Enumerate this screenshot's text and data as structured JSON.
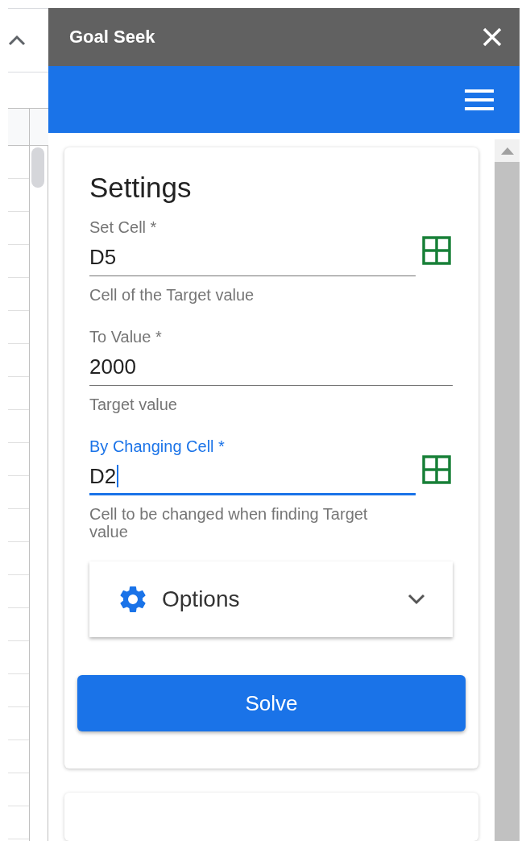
{
  "dialog": {
    "title": "Goal Seek"
  },
  "section": {
    "title": "Settings"
  },
  "fields": [
    {
      "label": "Set Cell *",
      "value": "D5",
      "hint": "Cell of the Target value",
      "focused": false,
      "has_picker": true
    },
    {
      "label": "To Value *",
      "value": "2000",
      "hint": "Target value",
      "focused": false,
      "has_picker": false
    },
    {
      "label": "By Changing Cell *",
      "value": "D2",
      "hint": "Cell to be changed when finding Target value",
      "focused": true,
      "has_picker": true
    }
  ],
  "options": {
    "label": "Options",
    "expanded": false
  },
  "solve_button": {
    "label": "Solve"
  }
}
